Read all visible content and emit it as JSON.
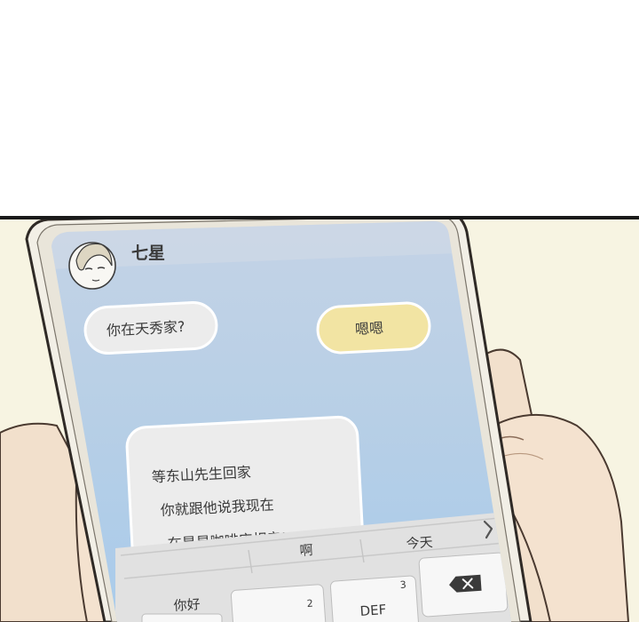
{
  "contact": {
    "name": "七星",
    "avatar_icon": "woman-portrait-avatar"
  },
  "messages": [
    {
      "sender": "contact",
      "text": "你在天秀家?"
    },
    {
      "sender": "me",
      "text": "嗯嗯"
    },
    {
      "sender": "contact",
      "lines": [
        "等东山先生回家",
        "你就跟他说我现在",
        "在星星咖啡店相亲!"
      ]
    }
  ],
  "keyboard": {
    "suggestions": [
      "你好",
      "啊",
      "今天"
    ],
    "expand_icon": "chevron-right-icon",
    "keys": [
      {
        "label": "",
        "number": "2"
      },
      {
        "label": "DEF",
        "number": "3"
      }
    ],
    "delete_icon": "backspace-icon"
  },
  "colors": {
    "scene_background": "#f7f4e2",
    "phone_frame": "#f2efe6",
    "chat_background": "#b3cfe7",
    "incoming_bubble": "#ececec",
    "outgoing_bubble": "#f2e4a3",
    "keyboard_background": "#e1e1e1"
  }
}
